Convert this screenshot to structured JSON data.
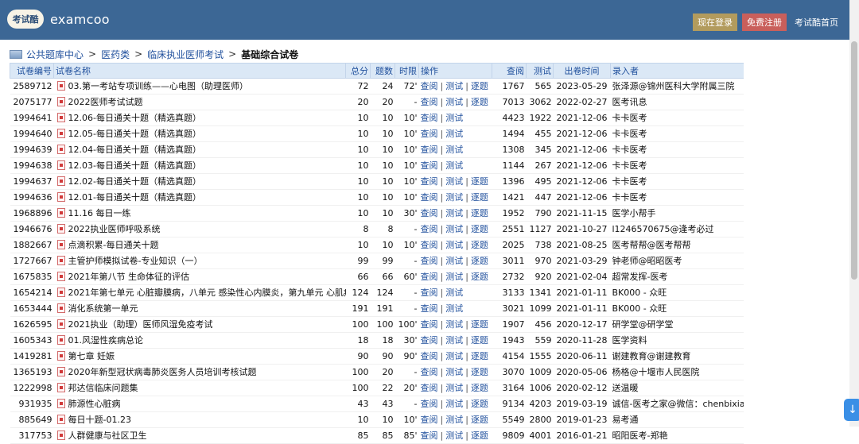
{
  "header": {
    "logo_badge": "考试酷",
    "logo_text": "examcoo",
    "login_label": "现在登录",
    "register_label": "免费注册",
    "home_label": "考试酷首页"
  },
  "breadcrumb": {
    "items": [
      "公共题库中心",
      "医药类",
      "临床执业医师考试"
    ],
    "current": "基础综合试卷",
    "separator": ">"
  },
  "table": {
    "headers": [
      "试卷编号",
      "试卷名称",
      "总分",
      "题数",
      "时限",
      "操作",
      "查阅",
      "测试",
      "出卷时间",
      "录入者"
    ],
    "op_labels": {
      "view": "查阅",
      "test": "测试",
      "step": "逐题",
      "sep": "|"
    },
    "rows": [
      {
        "id": "2589712",
        "name": "03.第一考站专项训练——心电图（助理医师）",
        "score": "72",
        "count": "24",
        "limit": "72'",
        "step": true,
        "views": "1767",
        "tests": "565",
        "date": "2023-05-29",
        "author": "张泽源@锦州医科大学附属三院"
      },
      {
        "id": "2075177",
        "name": "2022医师考试试题",
        "score": "20",
        "count": "20",
        "limit": "-",
        "step": true,
        "views": "7013",
        "tests": "3062",
        "date": "2022-02-27",
        "author": "医考讯息"
      },
      {
        "id": "1994641",
        "name": "12.06-每日通关十题（精选真题）",
        "score": "10",
        "count": "10",
        "limit": "10'",
        "step": false,
        "views": "4423",
        "tests": "1922",
        "date": "2021-12-06",
        "author": "卡卡医考"
      },
      {
        "id": "1994640",
        "name": "12.05-每日通关十题（精选真题）",
        "score": "10",
        "count": "10",
        "limit": "10'",
        "step": false,
        "views": "1494",
        "tests": "455",
        "date": "2021-12-06",
        "author": "卡卡医考"
      },
      {
        "id": "1994639",
        "name": "12.04-每日通关十题（精选真题）",
        "score": "10",
        "count": "10",
        "limit": "10'",
        "step": false,
        "views": "1308",
        "tests": "345",
        "date": "2021-12-06",
        "author": "卡卡医考"
      },
      {
        "id": "1994638",
        "name": "12.03-每日通关十题（精选真题）",
        "score": "10",
        "count": "10",
        "limit": "10'",
        "step": false,
        "views": "1144",
        "tests": "267",
        "date": "2021-12-06",
        "author": "卡卡医考"
      },
      {
        "id": "1994637",
        "name": "12.02-每日通关十题（精选真题）",
        "score": "10",
        "count": "10",
        "limit": "10'",
        "step": true,
        "views": "1396",
        "tests": "495",
        "date": "2021-12-06",
        "author": "卡卡医考"
      },
      {
        "id": "1994636",
        "name": "12.01-每日通关十题（精选真题）",
        "score": "10",
        "count": "10",
        "limit": "10'",
        "step": true,
        "views": "1421",
        "tests": "447",
        "date": "2021-12-06",
        "author": "卡卡医考"
      },
      {
        "id": "1968896",
        "name": "11.16 每日一练",
        "score": "10",
        "count": "10",
        "limit": "30'",
        "step": true,
        "views": "1952",
        "tests": "790",
        "date": "2021-11-15",
        "author": "医学小帮手"
      },
      {
        "id": "1946676",
        "name": "2022执业医师呼吸系统",
        "score": "8",
        "count": "8",
        "limit": "-",
        "step": true,
        "views": "2551",
        "tests": "1127",
        "date": "2021-10-27",
        "author": "l1246570675@逢考必过"
      },
      {
        "id": "1882667",
        "name": "点滴积累-每日通关十题",
        "score": "10",
        "count": "10",
        "limit": "10'",
        "step": true,
        "views": "2025",
        "tests": "738",
        "date": "2021-08-25",
        "author": "医考帮帮@医考帮帮"
      },
      {
        "id": "1727667",
        "name": "主管护师模拟试卷-专业知识（一）",
        "score": "99",
        "count": "99",
        "limit": "-",
        "step": true,
        "views": "3011",
        "tests": "970",
        "date": "2021-03-29",
        "author": "钟老师@昭昭医考"
      },
      {
        "id": "1675835",
        "name": "2021年第八节 生命体征的评估",
        "score": "66",
        "count": "66",
        "limit": "60'",
        "step": true,
        "views": "2732",
        "tests": "920",
        "date": "2021-02-04",
        "author": "超常发挥-医考"
      },
      {
        "id": "1654214",
        "name": "2021年第七单元 心脏瓣膜病，八单元 感染性心内膜炎，第九单元 心肌疾病",
        "score": "124",
        "count": "124",
        "limit": "-",
        "step": false,
        "views": "3133",
        "tests": "1341",
        "date": "2021-01-11",
        "author": "BK000 - 众旺"
      },
      {
        "id": "1653444",
        "name": "消化系统第一单元",
        "score": "191",
        "count": "191",
        "limit": "-",
        "step": false,
        "views": "3021",
        "tests": "1099",
        "date": "2021-01-11",
        "author": "BK000 - 众旺"
      },
      {
        "id": "1626595",
        "name": "2021执业（助理）医师风湿免疫考试",
        "score": "100",
        "count": "100",
        "limit": "100'",
        "step": true,
        "views": "1907",
        "tests": "456",
        "date": "2020-12-17",
        "author": "研学堂@研学堂"
      },
      {
        "id": "1605343",
        "name": "01.风湿性疾病总论",
        "score": "18",
        "count": "18",
        "limit": "30'",
        "step": true,
        "views": "1943",
        "tests": "559",
        "date": "2020-11-28",
        "author": "医学资料"
      },
      {
        "id": "1419281",
        "name": "第七章 妊娠",
        "score": "90",
        "count": "90",
        "limit": "90'",
        "step": true,
        "views": "4154",
        "tests": "1555",
        "date": "2020-06-11",
        "author": "谢建教育@谢建教育"
      },
      {
        "id": "1365193",
        "name": "2020年新型冠状病毒肺炎医务人员培训考核试题",
        "score": "100",
        "count": "20",
        "limit": "-",
        "step": true,
        "views": "3070",
        "tests": "1009",
        "date": "2020-05-06",
        "author": "杨格@十堰市人民医院"
      },
      {
        "id": "1222998",
        "name": "邦达信临床问题集",
        "score": "100",
        "count": "22",
        "limit": "20'",
        "step": true,
        "views": "3164",
        "tests": "1006",
        "date": "2020-02-12",
        "author": "送温暖"
      },
      {
        "id": "931935",
        "name": "肺源性心脏病",
        "score": "43",
        "count": "43",
        "limit": "-",
        "step": true,
        "views": "9134",
        "tests": "4203",
        "date": "2019-03-19",
        "author": "诚信-医考之家@微信：chenbixia"
      },
      {
        "id": "885649",
        "name": "每日十题-01.23",
        "score": "10",
        "count": "10",
        "limit": "10'",
        "step": true,
        "views": "5549",
        "tests": "2800",
        "date": "2019-01-23",
        "author": "易考通"
      },
      {
        "id": "317753",
        "name": "人群健康与社区卫生",
        "score": "85",
        "count": "85",
        "limit": "85'",
        "step": true,
        "views": "9809",
        "tests": "4001",
        "date": "2016-01-21",
        "author": "昭阳医考-郑艳"
      }
    ]
  },
  "icons": {
    "pdf": "document-icon",
    "breadcrumb": "folder-icon",
    "back_to_top": "arrow-up-icon"
  },
  "colors": {
    "header_bg": "#3c6795",
    "login_bg": "#b29b5d",
    "register_bg": "#c95f5b",
    "link": "#1f4f9c",
    "table_header_bg": "#dbe8f6"
  }
}
